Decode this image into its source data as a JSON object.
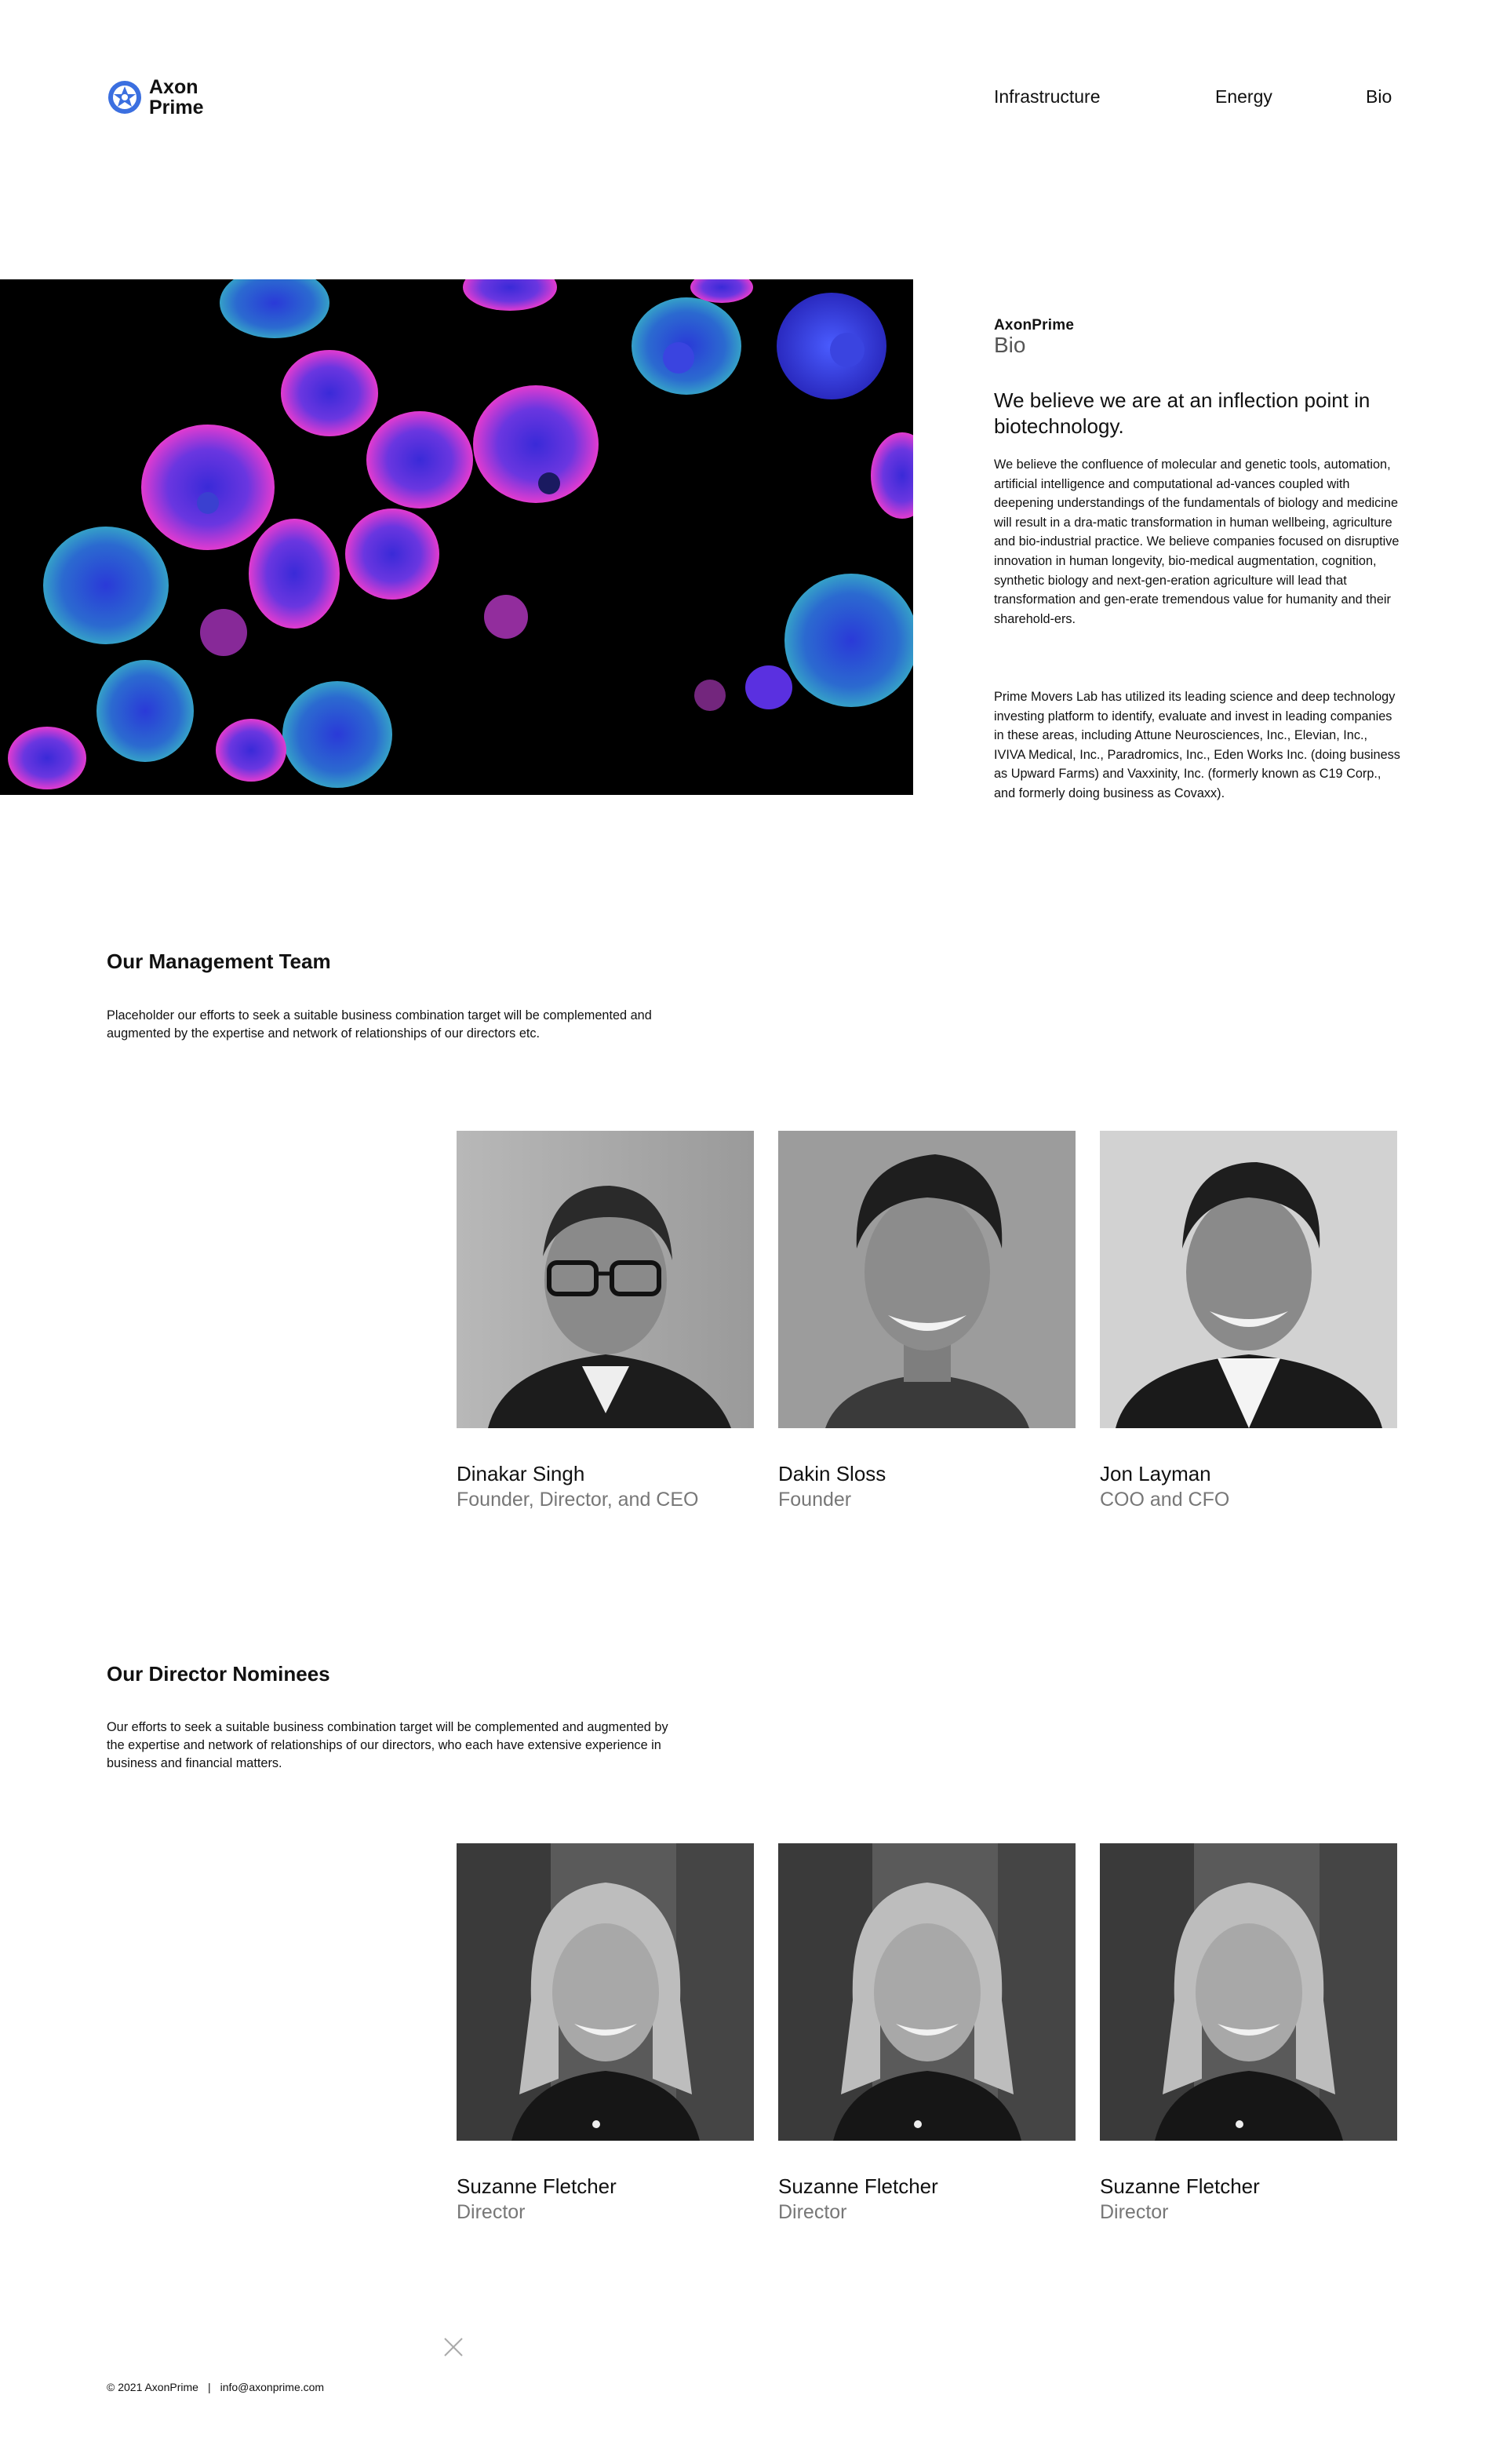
{
  "brand": {
    "line1": "Axon",
    "line2": "Prime",
    "logo_icon": "star-molecule-icon",
    "accent": "#3b6fe0"
  },
  "nav": {
    "items": [
      "Infrastructure",
      "Energy",
      "Bio"
    ]
  },
  "hero": {
    "brand_top": "AxonPrime",
    "brand_sub": "Bio",
    "headline": "We believe we are at an inflection point in biotechnology.",
    "paragraph1": "We believe the confluence of molecular and genetic tools, automation, artificial intelligence and computational ad-vances coupled with deepening understandings of the fundamentals of biology and medicine will result in a dra-matic transformation in human wellbeing, agriculture and bio-industrial practice. We believe companies focused on disruptive innovation in human longevity, bio-medical augmentation, cognition, synthetic biology and next-gen-eration agriculture will lead that transformation and gen-erate tremendous value for humanity and their sharehold-ers.",
    "paragraph2": "Prime Movers Lab has utilized its leading science and deep technology investing platform to identify, evaluate and invest in leading companies in these areas, including Attune Neurosciences, Inc., Elevian, Inc., IVIVA Medical, Inc., Paradromics, Inc., Eden Works Inc. (doing business as Upward Farms) and Vaxxinity, Inc. (formerly known as C19 Corp., and formerly doing business as Covaxx)."
  },
  "management": {
    "title": "Our Management Team",
    "description": "Placeholder our efforts to seek a suitable business combination target will be complemented and augmented by the expertise and network of relationships of our directors etc.",
    "people": [
      {
        "name": "Dinakar Singh",
        "role": "Founder, Director, and CEO"
      },
      {
        "name": "Dakin Sloss",
        "role": "Founder"
      },
      {
        "name": "Jon Layman",
        "role": "COO and CFO"
      }
    ]
  },
  "directors": {
    "title": "Our Director Nominees",
    "description": "Our efforts to seek a suitable business combination target will be complemented and augmented by the expertise and network of relationships of our directors, who each have extensive experience in business and financial matters.",
    "people": [
      {
        "name": "Suzanne Fletcher",
        "role": "Director"
      },
      {
        "name": "Suzanne Fletcher",
        "role": "Director"
      },
      {
        "name": "Suzanne Fletcher",
        "role": "Director"
      }
    ]
  },
  "footer": {
    "copyright": "© 2021 AxonPrime",
    "separator": "|",
    "email": "info@axonprime.com"
  }
}
